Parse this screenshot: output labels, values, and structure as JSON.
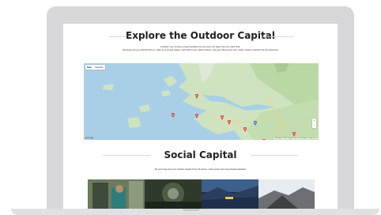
{
  "section1": {
    "title": "Explore the Outdoor Capital",
    "intro_line1": "Lochaber may not have a huge population but the area is far larger than you might think.",
    "intro_line2": "Dig deeper and you will find that it is made up of several regions, each with its own, distinct flavour, and each offering their own unique Outdoor Capital of the UK Adventure!"
  },
  "map": {
    "tabs": [
      "Map",
      "Satellite"
    ],
    "zoom_in": "+",
    "zoom_out": "−",
    "logo": "Google",
    "attribution": "Map data ©2017 Google  Terms of Use  Report a map error",
    "marker_count": 12,
    "colors": {
      "water": "#a9cfe6",
      "land": "#cfe3c0",
      "marker": "#e0433a",
      "active_marker": "#3d6fd8"
    }
  },
  "section2": {
    "title": "Social Capital",
    "intro": "Be seen! Tag all of your Outdoor Capital of the UK photos, videos and posts using #outdoorcapitaluk"
  }
}
